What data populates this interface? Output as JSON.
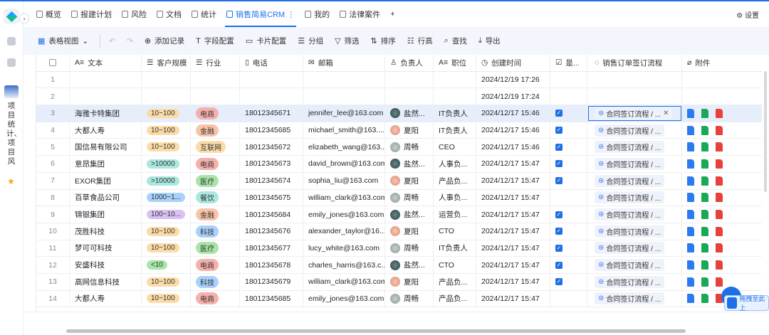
{
  "tabs": [
    {
      "label": "概览"
    },
    {
      "label": "报建计划"
    },
    {
      "label": "风险"
    },
    {
      "label": "文档"
    },
    {
      "label": "统计"
    },
    {
      "label": "销售简易CRM ⋮",
      "active": true
    },
    {
      "label": "我的"
    },
    {
      "label": "法律案件"
    }
  ],
  "add_tab": "+",
  "settings": "设置",
  "sidebar": {
    "project_label": "项目统计、项目风",
    "expand": "›"
  },
  "toolbar": {
    "view": "表格视图",
    "undo": "↶",
    "redo": "↷",
    "items": [
      {
        "icon": "⊕",
        "label": "添加记录"
      },
      {
        "icon": "T",
        "label": "字段配置"
      },
      {
        "icon": "▭",
        "label": "卡片配置"
      },
      {
        "icon": "☰",
        "label": "分组"
      },
      {
        "icon": "▽",
        "label": "筛选"
      },
      {
        "icon": "⇅",
        "label": "排序"
      },
      {
        "icon": "☷",
        "label": "行高"
      },
      {
        "icon": "⌕",
        "label": "查找"
      },
      {
        "icon": "⤓",
        "label": "导出"
      }
    ]
  },
  "columns": [
    {
      "icon": "A≡",
      "label": "文本"
    },
    {
      "icon": "☰",
      "label": "客户规模"
    },
    {
      "icon": "☰",
      "label": "行业"
    },
    {
      "icon": "▯",
      "label": "电话"
    },
    {
      "icon": "✉",
      "label": "邮箱"
    },
    {
      "icon": "♙",
      "label": "负责人"
    },
    {
      "icon": "A≡",
      "label": "职位"
    },
    {
      "icon": "◷",
      "label": "创建时间"
    },
    {
      "icon": "☑",
      "label": "是..."
    },
    {
      "icon": "◌",
      "label": "销售订单签订流程"
    },
    {
      "icon": "⌀",
      "label": "附件"
    }
  ],
  "colors": {
    "accent": "#1f6fe8",
    "scale": {
      "10~100": "#fbdca8",
      "1000~1...": "#a9d1fb",
      ">10000": "#a9e8e0",
      "100~10...": "#d9c1f5",
      "<10": "#a8e6a8"
    },
    "industry": {
      "电商": "#f6b0ac",
      "金融": "#f9c3a8",
      "互联网": "#fbdca8",
      "医疗": "#a8e6a8",
      "餐饮": "#a9e8e0",
      "科技": "#a9d1fb"
    }
  },
  "rows": [
    {
      "n": "1",
      "name": "",
      "scale": "",
      "ind": "",
      "phone": "",
      "email": "",
      "owner": "",
      "pos": "",
      "time": "2024/12/19 17:26",
      "chk": false,
      "flow": "",
      "files": false
    },
    {
      "n": "2",
      "name": "",
      "scale": "",
      "ind": "",
      "phone": "",
      "email": "",
      "owner": "",
      "pos": "",
      "time": "2024/12/19 17:24",
      "chk": false,
      "flow": "",
      "files": false
    },
    {
      "n": "3",
      "name": "海雅卡特集团",
      "scale": "10~100",
      "ind": "电商",
      "phone": "18012345671",
      "email": "jennifer_lee@163.com",
      "owner": "盐然...",
      "pos": "IT负责人",
      "time": "2024/12/17 15:46",
      "chk": true,
      "flow": "合同签订流程 / ...",
      "files": true,
      "sel": true
    },
    {
      "n": "4",
      "name": "大都人寿",
      "scale": "10~100",
      "ind": "金融",
      "phone": "18012345685",
      "email": "michael_smith@163....",
      "owner": "夏阳",
      "pos": "IT负责人",
      "time": "2024/12/17 15:46",
      "chk": true,
      "flow": "合同签订流程 / ...",
      "files": true
    },
    {
      "n": "5",
      "name": "国信易有限公司",
      "scale": "10~100",
      "ind": "互联网",
      "phone": "18012345672",
      "email": "elizabeth_wang@163...",
      "owner": "周畅",
      "pos": "CEO",
      "time": "2024/12/17 15:46",
      "chk": true,
      "flow": "合同签订流程 / ...",
      "files": true
    },
    {
      "n": "6",
      "name": "意昂集团",
      "scale": ">10000",
      "ind": "电商",
      "phone": "18012345673",
      "email": "david_brown@163.com",
      "owner": "盐然...",
      "pos": "人事负...",
      "time": "2024/12/17 15:47",
      "chk": true,
      "flow": "合同签订流程 / ...",
      "files": true
    },
    {
      "n": "7",
      "name": "EXOR集团",
      "scale": ">10000",
      "ind": "医疗",
      "phone": "18012345674",
      "email": "sophia_liu@163.com",
      "owner": "夏阳",
      "pos": "产品负...",
      "time": "2024/12/17 15:47",
      "chk": true,
      "flow": "合同签订流程 / ...",
      "files": true
    },
    {
      "n": "8",
      "name": "百草食品公司",
      "scale": "1000~1...",
      "ind": "餐饮",
      "phone": "18012345675",
      "email": "william_clark@163.com",
      "owner": "周畅",
      "pos": "人事负...",
      "time": "2024/12/17 15:47",
      "chk": false,
      "flow": "合同签订流程 / ...",
      "files": true
    },
    {
      "n": "9",
      "name": "锦银集团",
      "scale": "100~10...",
      "ind": "金融",
      "phone": "18012345684",
      "email": "emily_jones@163.com",
      "owner": "盐然...",
      "pos": "运营负...",
      "time": "2024/12/17 15:47",
      "chk": true,
      "flow": "合同签订流程 / ...",
      "files": true
    },
    {
      "n": "10",
      "name": "茂胜科技",
      "scale": "10~100",
      "ind": "科技",
      "phone": "18012345676",
      "email": "alexander_taylor@16...",
      "owner": "夏阳",
      "pos": "CTO",
      "time": "2024/12/17 15:47",
      "chk": true,
      "flow": "合同签订流程 / ...",
      "files": true
    },
    {
      "n": "11",
      "name": "梦可可科技",
      "scale": "10~100",
      "ind": "医疗",
      "phone": "18012345677",
      "email": "lucy_white@163.com",
      "owner": "周畅",
      "pos": "IT负责人",
      "time": "2024/12/17 15:47",
      "chk": true,
      "flow": "合同签订流程 / ...",
      "files": true
    },
    {
      "n": "12",
      "name": "安盛科技",
      "scale": "<10",
      "ind": "电商",
      "phone": "18012345678",
      "email": "charles_harris@163.c...",
      "owner": "盐然...",
      "pos": "CTO",
      "time": "2024/12/17 15:47",
      "chk": true,
      "flow": "合同签订流程 / ...",
      "files": true
    },
    {
      "n": "13",
      "name": "高网信息科技",
      "scale": "10~100",
      "ind": "科技",
      "phone": "18012345679",
      "email": "william_clark@163.com",
      "owner": "夏阳",
      "pos": "产品负...",
      "time": "2024/12/17 15:47",
      "chk": true,
      "flow": "合同签订流程 / ...",
      "files": true
    },
    {
      "n": "14",
      "name": "大都人寿",
      "scale": "10~100",
      "ind": "电商",
      "phone": "18012345685",
      "email": "emily_jones@163.com",
      "owner": "周畅",
      "pos": "产品负...",
      "time": "2024/12/17 15:47",
      "chk": false,
      "flow": "合同签订流程 / ...",
      "files": true
    }
  ],
  "drag_hint": "拖拽至此上"
}
